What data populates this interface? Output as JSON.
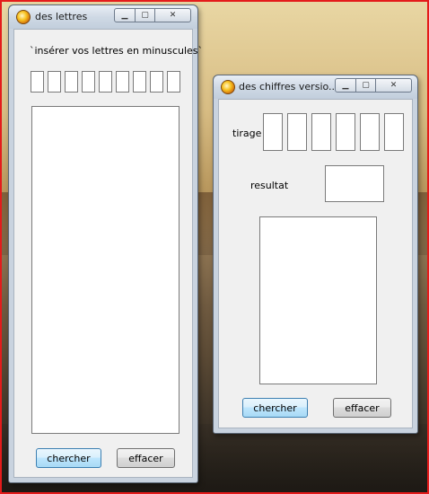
{
  "letters_window": {
    "title": "des lettres",
    "instruction": "`insérer vos lettres en minuscules`",
    "letter_cells": [
      "",
      "",
      "",
      "",
      "",
      "",
      "",
      "",
      ""
    ],
    "result_area": "",
    "search_button": "chercher",
    "clear_button": "effacer"
  },
  "numbers_window": {
    "title": "des chiffres versio...",
    "draw_label": "tirage",
    "draw_cells": [
      "",
      "",
      "",
      "",
      "",
      ""
    ],
    "result_label": "resultat",
    "result_value": "",
    "output_area": "",
    "search_button": "chercher",
    "clear_button": "effacer"
  },
  "window_controls": {
    "minimize_icon": "minimize-icon",
    "maximize_icon": "maximize-icon",
    "close_icon": "close-icon"
  }
}
